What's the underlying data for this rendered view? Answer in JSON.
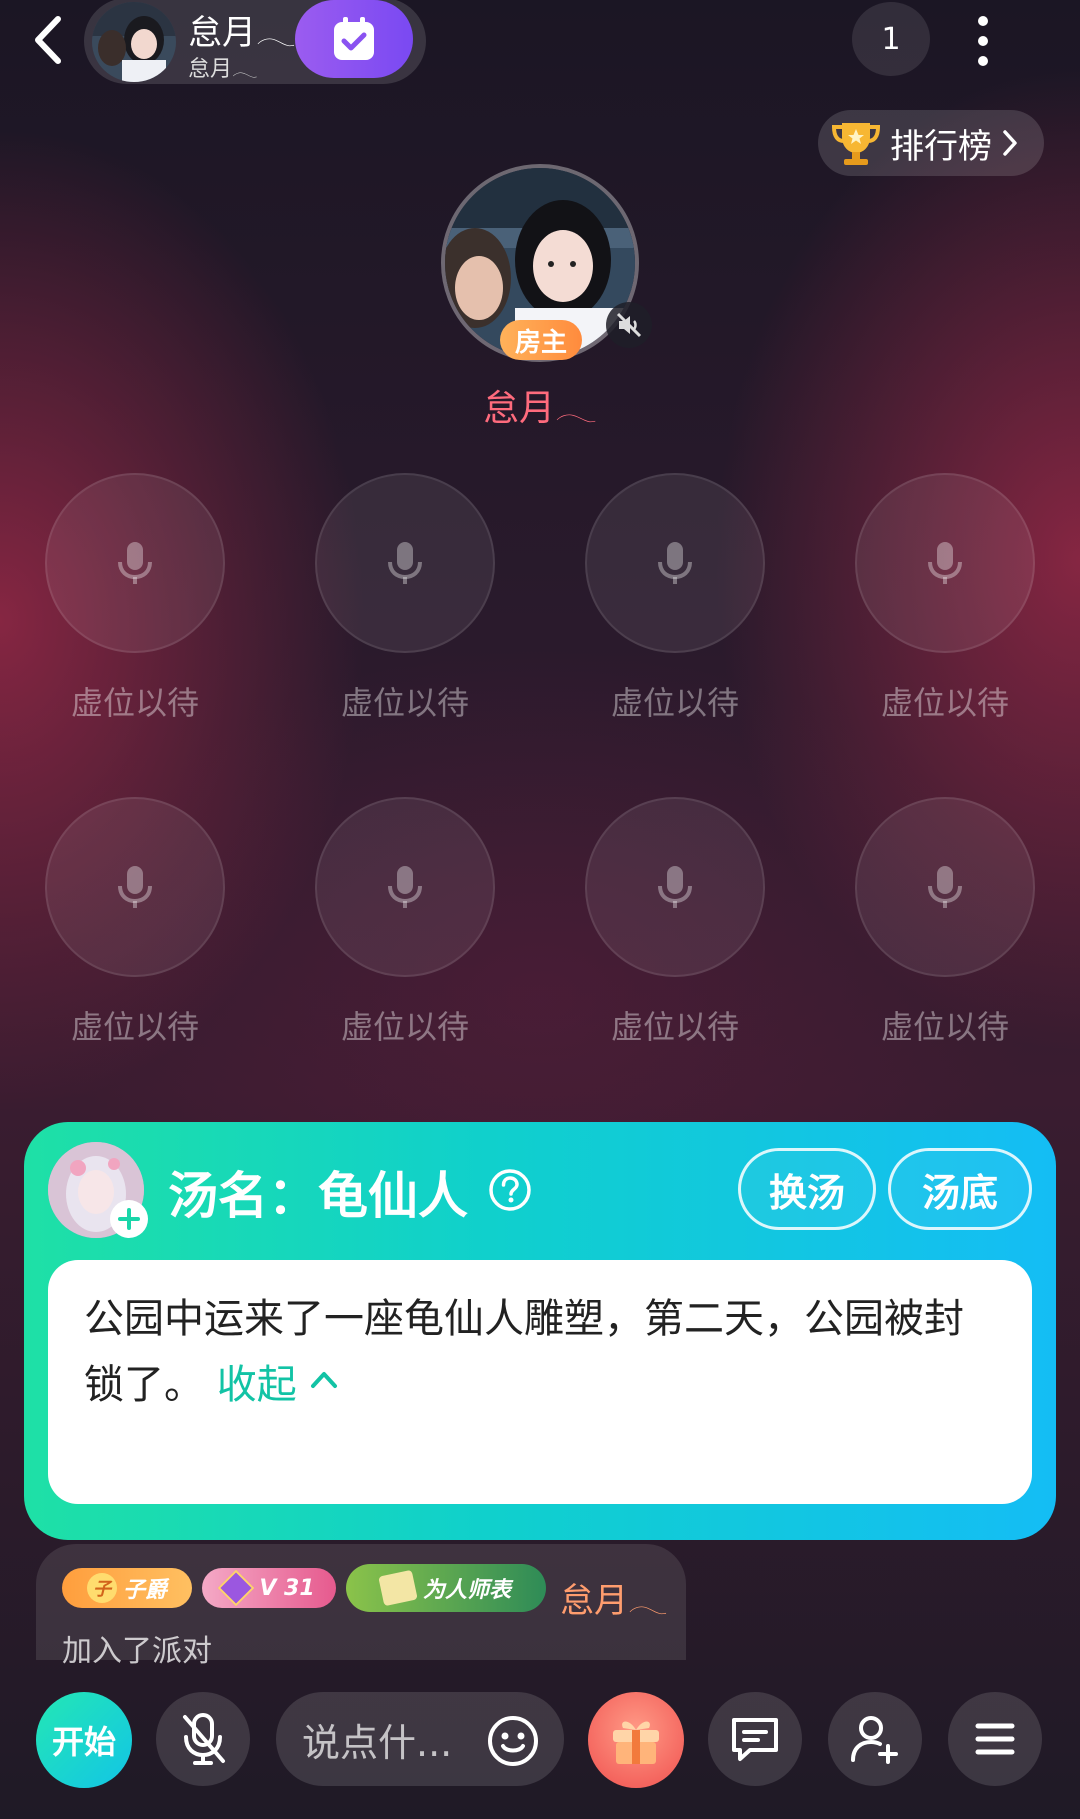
{
  "top_bar": {
    "room_title": "怠月𓂃",
    "room_subtitle": "怠月𓂃",
    "online_count": "1"
  },
  "rank_label": "排行榜",
  "host": {
    "badge": "房主",
    "name": "怠月𓂃"
  },
  "seats": [
    {
      "label": "虚位以待"
    },
    {
      "label": "虚位以待"
    },
    {
      "label": "虚位以待"
    },
    {
      "label": "虚位以待"
    },
    {
      "label": "虚位以待"
    },
    {
      "label": "虚位以待"
    },
    {
      "label": "虚位以待"
    },
    {
      "label": "虚位以待"
    }
  ],
  "soup": {
    "title": "汤名：龟仙人",
    "change_label": "换汤",
    "answer_label": "汤底",
    "description": "公园中运来了一座龟仙人雕塑，第二天，公园被封锁了。",
    "collapse_label": "收起"
  },
  "chat": {
    "badge_rank": "子爵",
    "badge_rank_char": "子",
    "badge_vip": "V 31",
    "badge_title": "为人师表",
    "user": "怠月𓂃",
    "message": "加入了派对"
  },
  "bottom_bar": {
    "start_label": "开始",
    "input_placeholder": "说点什..."
  },
  "colors": {
    "accent_green": "#1ee0a6",
    "accent_cyan": "#14bdf5",
    "checkin_purple": "#8a52f1",
    "host_name": "#ff6b7d",
    "gift_red": "#f0514f"
  }
}
